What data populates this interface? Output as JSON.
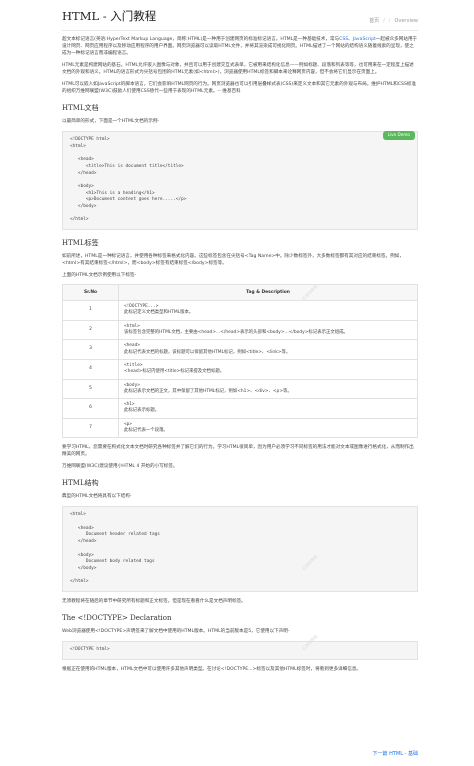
{
  "header": {
    "title": "HTML - 入门教程",
    "breadcrumb": {
      "home": "首页",
      "sep1": "/",
      "sep2": "/",
      "current": "Overview"
    }
  },
  "intro": {
    "p1_part1": "超文本标记语言(英语:HyperText Markup Language，简称:HTML)是一种用于创建网页的标准标记语言。HTML是一种基础技术，常与",
    "p1_link1": "CSS",
    "p1_part2": "、",
    "p1_link2": "JavaScript",
    "p1_part3": "一起被众多网站用于设计网页、网页应用程序以及移动应用程序的用户界面。网页浏览器可以读取HTML文件，并将其渲染成可视化网页。HTML描述了一个网站的结构语义随着线索的呈现，使之成为一种标记语言而非编程语言。",
    "p2": "HTML元素是构建网站的基石。HTML允许嵌入图像与对象，并且可以用于创建交互式表单，它被用来结构化信息——例如标题、段落和列表等等，也可用来在一定程度上描述文档的外观和语义。HTML的语言形式为尖括号包围的HTML元素(如<html>)，浏览器使用HTML标签和脚本来诠释网页内容，但不会将它们显示在页面上。",
    "p3": "HTML可以嵌入如JavaScript的脚本语言，它们会影响HTML网页的行为。网页浏览器也可以引用层叠样式表(CSS)来定义文本和其它元素的外观与布局。维护HTML和CSS标准的组织万维网联盟(W3C)鼓励人们使用CSS替代一些用于表现的HTML元素。-- 维基百科"
  },
  "section_doc": {
    "heading": "HTML文档",
    "desc": "以最简单的形式，下面是一个HTML文档的示例-",
    "live_demo": "Live Demo",
    "code": "<!DOCTYPE html>\n<html>\n\n   <head>\n      <title>This is document title</title>\n   </head>\n\n   <body>\n      <h1>This is a heading</h1>\n      <p>Document content goes here.....</p>\n   </body>\n\n</html>"
  },
  "section_tags": {
    "heading": "HTML标签",
    "p1": "如前所述，HTML是一种标记语言，并使用各种标签来格式化内容。这些标签包含在尖括号<Tag Name>中。除少数标签外，大多数标签都有其对应的结束标签。例如，<html>有其结束标签</html>，而<body>标签有结束标签</body>标签等。",
    "p2": "上面的HTML文档示例使用以下标签-",
    "table": {
      "headers": [
        "Sr.No",
        "Tag & Description"
      ],
      "rows": [
        {
          "num": "1",
          "tag": "<!DOCTYPE...>",
          "desc": "此标记定义文档类型和HTML版本。"
        },
        {
          "num": "2",
          "tag": "<html>",
          "desc": "该标签包含完整的HTML文档，主要由<head>...</head>表示的头部和<body>...</body>标记表示正文组成。"
        },
        {
          "num": "3",
          "tag": "<head>",
          "desc": "此标记代表文档的标题，该标题可以保留其他HTML标记，例如<title>、<link>等。"
        },
        {
          "num": "4",
          "tag": "<title>",
          "desc": "<head>标记内使用<title>标记来提及文档标题。"
        },
        {
          "num": "5",
          "tag": "<body>",
          "desc": "此标记表示文档的正文，其中保留了其他HTML标记，例如<h1>、<div>、<p>等。"
        },
        {
          "num": "6",
          "tag": "<h1>",
          "desc": "此标记表示标题。"
        },
        {
          "num": "7",
          "tag": "<p>",
          "desc": "此标记代表一个段落。"
        }
      ]
    },
    "p3": "要学习HTML，您需要在构式化文本文档时研究各种标签并了解它们的行为。学习HTML很简单，因为用户必须学习不同标签的用法才能对文本或图像进行格式化，从而制作出精美的网页。",
    "p4": "万维网联盟(W3C)建议使用小HTML 4 开始的小写标签。"
  },
  "section_structure": {
    "heading": "HTML结构",
    "desc": "典型的HTML文档将具有以下结构-",
    "code": "<html>\n\n   <head>\n      Document header related tags\n   </head>\n\n   <body>\n      Document body related tags\n   </body>\n\n</html>",
    "after": "无须教程将在随后的章节中研究所有标题和正文标签，但是现在看看什么是文档声明标签。"
  },
  "section_doctype": {
    "heading": "The <!DOCTYPE> Declaration",
    "desc": "Web浏览器使用<!DOCTYPE>声明签来了解文档中使用的HTML版本。HTML的当前版本是5，它使用以下声明-",
    "code": "<!DOCTYPE html>",
    "after": "根据正在使用的HTML版本，HTML文档中可以使用许多其他声明类型。在讨论<!DOCTYPE...>标签以及其他HTML标签时，将看到更多详细信息。"
  },
  "footer": {
    "next": "下一篇 HTML - 基础"
  },
  "watermark": "云游网教程"
}
